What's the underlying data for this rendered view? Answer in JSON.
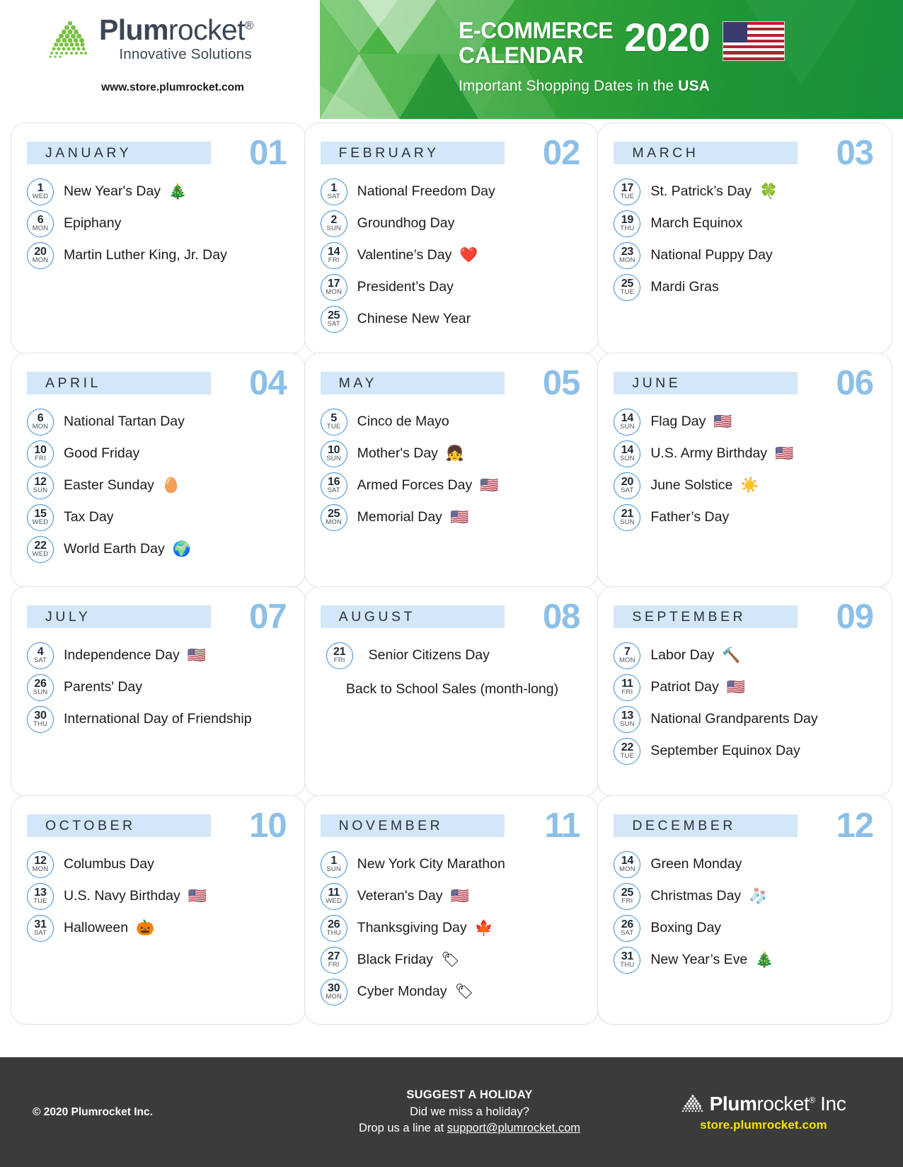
{
  "header": {
    "brand_name_bold": "Plum",
    "brand_name_light": "rocket",
    "brand_reg": "®",
    "brand_tagline": "Innovative Solutions",
    "website": "www.store.plumrocket.com",
    "title_line1": "E-COMMERCE",
    "title_line2": "CALENDAR",
    "year": "2020",
    "subtitle_prefix": "Important Shopping Dates in the ",
    "subtitle_bold": "USA",
    "flag_icon": "usa-flag-icon",
    "accent_green": "#35a439",
    "accent_blue": "#8cc0e8",
    "header_bar_blue": "#d4e7f8",
    "badge_blue": "#3b8fd4"
  },
  "months": [
    {
      "name": "JANUARY",
      "number": "01",
      "events": [
        {
          "day": "1",
          "weekday": "WED",
          "label": "New Year's Day",
          "icon": "🎄",
          "icon_name": "christmas-tree-icon"
        },
        {
          "day": "6",
          "weekday": "MON",
          "label": "Epiphany",
          "icon": "",
          "icon_name": ""
        },
        {
          "day": "20",
          "weekday": "MON",
          "label": "Martin Luther King, Jr. Day",
          "icon": "",
          "icon_name": ""
        }
      ],
      "note": ""
    },
    {
      "name": "FEBRUARY",
      "number": "02",
      "events": [
        {
          "day": "1",
          "weekday": "SAT",
          "label": "National Freedom Day",
          "icon": "",
          "icon_name": ""
        },
        {
          "day": "2",
          "weekday": "SUN",
          "label": "Groundhog Day",
          "icon": "",
          "icon_name": ""
        },
        {
          "day": "14",
          "weekday": "FRI",
          "label": "Valentine’s Day",
          "icon": "❤️",
          "icon_name": "heart-icon"
        },
        {
          "day": "17",
          "weekday": "MON",
          "label": "President’s Day",
          "icon": "",
          "icon_name": ""
        },
        {
          "day": "25",
          "weekday": "SAT",
          "label": "Chinese New Year",
          "icon": "",
          "icon_name": ""
        }
      ],
      "note": ""
    },
    {
      "name": "MARCH",
      "number": "03",
      "events": [
        {
          "day": "17",
          "weekday": "TUE",
          "label": "St. Patrick’s Day",
          "icon": "🍀",
          "icon_name": "clover-icon"
        },
        {
          "day": "19",
          "weekday": "THU",
          "label": "March Equinox",
          "icon": "",
          "icon_name": ""
        },
        {
          "day": "23",
          "weekday": "MON",
          "label": "National Puppy Day",
          "icon": "",
          "icon_name": ""
        },
        {
          "day": "25",
          "weekday": "TUE",
          "label": "Mardi Gras",
          "icon": "",
          "icon_name": ""
        }
      ],
      "note": ""
    },
    {
      "name": "APRIL",
      "number": "04",
      "events": [
        {
          "day": "6",
          "weekday": "MON",
          "label": "National Tartan Day",
          "icon": "",
          "icon_name": ""
        },
        {
          "day": "10",
          "weekday": "FRI",
          "label": "Good Friday",
          "icon": "",
          "icon_name": ""
        },
        {
          "day": "12",
          "weekday": "SUN",
          "label": "Easter Sunday",
          "icon": "🥚",
          "icon_name": "easter-egg-icon"
        },
        {
          "day": "15",
          "weekday": "WED",
          "label": "Tax Day",
          "icon": "",
          "icon_name": ""
        },
        {
          "day": "22",
          "weekday": "WED",
          "label": "World Earth Day",
          "icon": "🌍",
          "icon_name": "globe-icon"
        }
      ],
      "note": ""
    },
    {
      "name": "MAY",
      "number": "05",
      "events": [
        {
          "day": "5",
          "weekday": "TUE",
          "label": "Cinco de Mayo",
          "icon": "",
          "icon_name": ""
        },
        {
          "day": "10",
          "weekday": "SUN",
          "label": "Mother's Day",
          "icon": "👧",
          "icon_name": "mother-face-icon"
        },
        {
          "day": "16",
          "weekday": "SAT",
          "label": "Armed Forces Day",
          "icon": "🇺🇸",
          "icon_name": "usa-flag-icon"
        },
        {
          "day": "25",
          "weekday": "MON",
          "label": "Memorial Day",
          "icon": "🇺🇸",
          "icon_name": "usa-flag-icon"
        }
      ],
      "note": ""
    },
    {
      "name": "JUNE",
      "number": "06",
      "events": [
        {
          "day": "14",
          "weekday": "SUN",
          "label": "Flag Day",
          "icon": "🇺🇸",
          "icon_name": "usa-flag-icon"
        },
        {
          "day": "14",
          "weekday": "SUN",
          "label": "U.S. Army Birthday",
          "icon": "🇺🇸",
          "icon_name": "usa-flag-icon"
        },
        {
          "day": "20",
          "weekday": "SAT",
          "label": "June Solstice",
          "icon": "☀️",
          "icon_name": "sun-icon"
        },
        {
          "day": "21",
          "weekday": "SUN",
          "label": "Father’s Day",
          "icon": "",
          "icon_name": ""
        }
      ],
      "note": ""
    },
    {
      "name": "JULY",
      "number": "07",
      "events": [
        {
          "day": "4",
          "weekday": "SAT",
          "label": "Independence Day",
          "icon": "🇺🇸",
          "icon_name": "usa-flag-icon"
        },
        {
          "day": "26",
          "weekday": "SUN",
          "label": "Parents' Day",
          "icon": "",
          "icon_name": ""
        },
        {
          "day": "30",
          "weekday": "THU",
          "label": "International Day of Friendship",
          "icon": "",
          "icon_name": ""
        }
      ],
      "note": ""
    },
    {
      "name": "AUGUST",
      "number": "08",
      "events": [
        {
          "day": "21",
          "weekday": "FRI",
          "label": "Senior Citizens Day",
          "icon": "",
          "icon_name": ""
        }
      ],
      "note": "Back to School Sales (month-long)"
    },
    {
      "name": "SEPTEMBER",
      "number": "09",
      "events": [
        {
          "day": "7",
          "weekday": "MON",
          "label": "Labor Day",
          "icon": "🔨",
          "icon_name": "hammer-icon"
        },
        {
          "day": "11",
          "weekday": "FRI",
          "label": "Patriot Day",
          "icon": "🇺🇸",
          "icon_name": "usa-flag-icon"
        },
        {
          "day": "13",
          "weekday": "SUN",
          "label": "National Grandparents Day",
          "icon": "",
          "icon_name": ""
        },
        {
          "day": "22",
          "weekday": "TUE",
          "label": "September Equinox Day",
          "icon": "",
          "icon_name": ""
        }
      ],
      "note": ""
    },
    {
      "name": "OCTOBER",
      "number": "10",
      "events": [
        {
          "day": "12",
          "weekday": "MON",
          "label": "Columbus Day",
          "icon": "",
          "icon_name": ""
        },
        {
          "day": "13",
          "weekday": "TUE",
          "label": "U.S. Navy Birthday",
          "icon": "🇺🇸",
          "icon_name": "usa-flag-icon"
        },
        {
          "day": "31",
          "weekday": "SAT",
          "label": "Halloween",
          "icon": "🎃",
          "icon_name": "pumpkin-icon"
        }
      ],
      "note": ""
    },
    {
      "name": "NOVEMBER",
      "number": "11",
      "events": [
        {
          "day": "1",
          "weekday": "SUN",
          "label": "New York City Marathon",
          "icon": "",
          "icon_name": ""
        },
        {
          "day": "11",
          "weekday": "WED",
          "label": "Veteran's Day",
          "icon": "🇺🇸",
          "icon_name": "usa-flag-icon"
        },
        {
          "day": "26",
          "weekday": "THU",
          "label": "Thanksgiving Day",
          "icon": "🍁",
          "icon_name": "maple-leaf-icon"
        },
        {
          "day": "27",
          "weekday": "FRI",
          "label": "Black Friday",
          "icon": "🏷",
          "icon_name": "percent-tag-icon"
        },
        {
          "day": "30",
          "weekday": "MON",
          "label": "Cyber Monday",
          "icon": "🏷",
          "icon_name": "percent-tag-icon"
        }
      ],
      "note": ""
    },
    {
      "name": "DECEMBER",
      "number": "12",
      "events": [
        {
          "day": "14",
          "weekday": "MON",
          "label": "Green Monday",
          "icon": "",
          "icon_name": ""
        },
        {
          "day": "25",
          "weekday": "FRI",
          "label": "Christmas Day",
          "icon": "🧦",
          "icon_name": "stocking-icon"
        },
        {
          "day": "26",
          "weekday": "SAT",
          "label": "Boxing Day",
          "icon": "",
          "icon_name": ""
        },
        {
          "day": "31",
          "weekday": "THU",
          "label": "New Year’s Eve",
          "icon": "🎄",
          "icon_name": "christmas-tree-icon"
        }
      ],
      "note": ""
    }
  ],
  "footer": {
    "copyright": "© 2020 Plumrocket Inc.",
    "suggest_title": "SUGGEST A HOLIDAY",
    "suggest_line2": "Did we miss a holiday?",
    "suggest_line3_prefix": "Drop us a line at ",
    "suggest_email": "support@plumrocket.com",
    "brand_bold": "Plum",
    "brand_light": "rocket",
    "brand_reg": "®",
    "brand_suffix": " Inc",
    "store_url": "store.plumrocket.com",
    "background": "#3b3b3b",
    "url_color": "#f5e400"
  }
}
